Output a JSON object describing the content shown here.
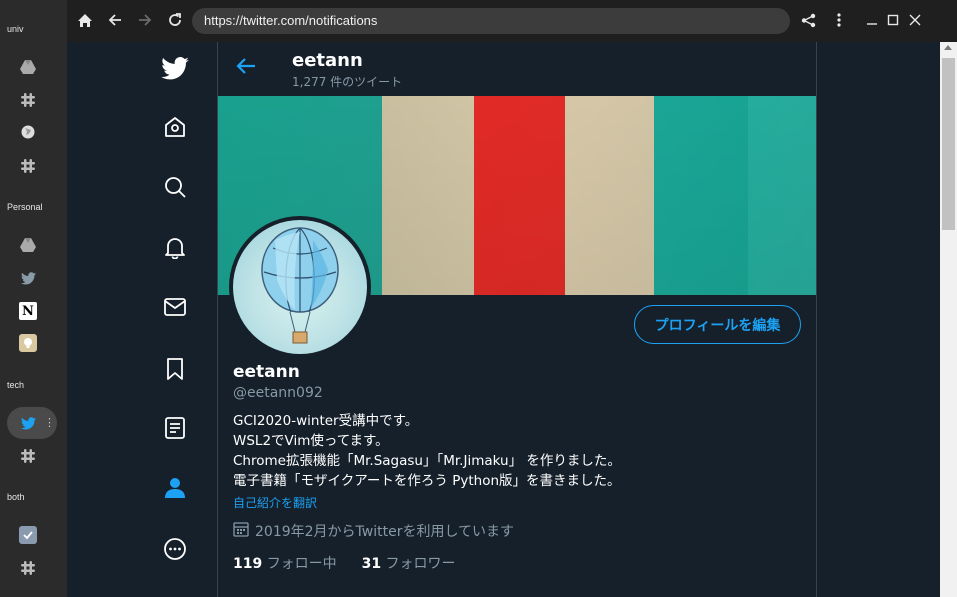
{
  "dock": {
    "groups": [
      {
        "label": "univ",
        "icons": [
          "drive-icon",
          "slack-icon",
          "globe-icon",
          "slack-icon"
        ]
      },
      {
        "label": "Personal",
        "icons": [
          "drive-icon",
          "twitter-icon",
          "notion-icon",
          "app-icon"
        ]
      },
      {
        "label": "tech",
        "icons": [
          "twitter-icon",
          "slack-icon"
        ]
      },
      {
        "label": "both",
        "icons": [
          "check-app-icon",
          "slack-icon"
        ]
      }
    ]
  },
  "browser": {
    "url": "https://twitter.com/notifications"
  },
  "header": {
    "title": "eetann",
    "tweet_count": "1,277 件のツイート"
  },
  "profile": {
    "edit_button": "プロフィールを編集",
    "name": "eetann",
    "handle": "@eetann092",
    "bio": [
      "GCI2020-winter受講中です。",
      "WSL2でVim使ってます。",
      "Chrome拡張機能「Mr.Sagasu」「Mr.Jimaku」 を作りました。",
      "電子書籍「モザイクアートを作ろう Python版」を書きました。"
    ],
    "translate_link": "自己紹介を翻訳",
    "joined": "2019年2月からTwitterを利用しています",
    "following_count": "119",
    "following_label": "フォロー中",
    "followers_count": "31",
    "followers_label": "フォロワー"
  },
  "colors": {
    "background": "#15202b",
    "accent": "#1da1f2",
    "secondary_text": "#8899a6"
  }
}
